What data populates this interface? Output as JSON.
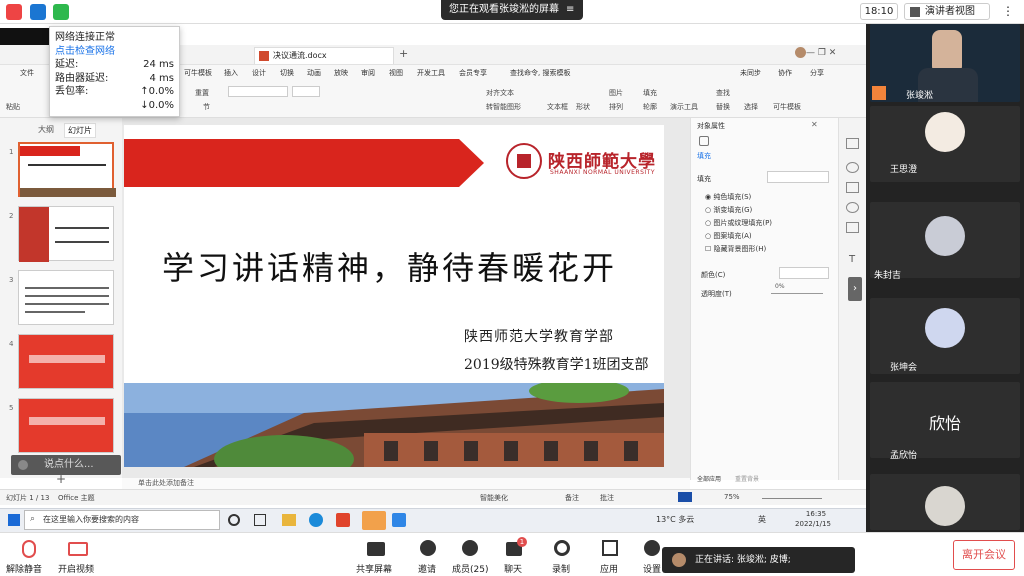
{
  "meeting": {
    "share_banner": "您正在观看张竣淞的屏幕",
    "clock": "18:10",
    "view_mode": "演讲者视图",
    "speaking_text": "正在讲话: 张竣淞; 皮博;",
    "leave_label": "离开会议"
  },
  "network": {
    "status": "网络连接正常",
    "check_link": "点击检查网络",
    "rows": [
      {
        "label": "延迟:",
        "value": "24 ms"
      },
      {
        "label": "路由器延迟:",
        "value": "4 ms"
      },
      {
        "label": "丢包率:",
        "value": "↑0.0%"
      },
      {
        "label": "",
        "value": "↓0.0%"
      }
    ]
  },
  "wps": {
    "doc_tab": "决议通流.docx",
    "menu": [
      "文件",
      "可牛模板",
      "插入",
      "设计",
      "切换",
      "动画",
      "放映",
      "审阅",
      "视图",
      "开发工具",
      "会员专享",
      "查找命令, 搜索模板"
    ],
    "menu_right": [
      "未同步",
      "协作",
      "分享"
    ],
    "ribbon": [
      "粘贴",
      "重置",
      "节",
      "文本框",
      "形状",
      "图片",
      "填充",
      "排列",
      "轮廓",
      "演示工具",
      "查找",
      "替换",
      "选择",
      "可牛模板",
      "对齐文本",
      "转智能图形"
    ],
    "pane_tabs": [
      "大纲",
      "幻灯片"
    ],
    "thumbs": [
      "1",
      "2",
      "3",
      "4",
      "5"
    ],
    "slide": {
      "university_cn": "陕西師範大學",
      "university_en": "SHAANXI NORMAL UNIVERSITY",
      "title": "学习讲话精神，静待春暖花开",
      "line1": "陕西师范大学教育学部",
      "line2": "2019级特殊教育学1班团支部"
    },
    "notes_placeholder": "单击此处添加备注",
    "status_left": "幻灯片 1 / 13",
    "status_theme": "Office 主题",
    "status_right": [
      "智能美化",
      "备注",
      "批注"
    ],
    "zoom": "75%",
    "props": {
      "title": "对象属性",
      "tab": "填充",
      "section": "填充",
      "options": [
        "纯色填充(S)",
        "渐变填充(G)",
        "图片或纹理填充(P)",
        "图案填充(A)",
        "隐藏背景图形(H)"
      ],
      "color_label": "颜色(C)",
      "transparency_label": "透明度(T)",
      "transparency_value": "0%",
      "apply_all": "全部应用",
      "reset_bg": "重置背景"
    },
    "chat_placeholder": "说点什么..."
  },
  "taskbar": {
    "search": "在这里输入你要搜索的内容",
    "weather": "13°C 多云",
    "lang": "英",
    "time": "16:35",
    "date": "2022/1/15"
  },
  "participants": [
    {
      "name": "张竣淞"
    },
    {
      "name": "王思澄"
    },
    {
      "name": "朱封吉"
    },
    {
      "name": "张坤会"
    },
    {
      "name": "孟欣怡",
      "tile_text": "欣怡"
    },
    {
      "name": ""
    }
  ],
  "toolbar": {
    "unmute": "解除静音",
    "video": "开启视频",
    "share": "共享屏幕",
    "invite": "邀请",
    "members": "成员(25)",
    "chat": "聊天",
    "chat_badge": "1",
    "record": "录制",
    "apps": "应用",
    "settings": "设置"
  },
  "colors": {
    "accent_red": "#d9251d",
    "zoom_blue": "#0e71eb",
    "leave_red": "#e14d4d"
  }
}
